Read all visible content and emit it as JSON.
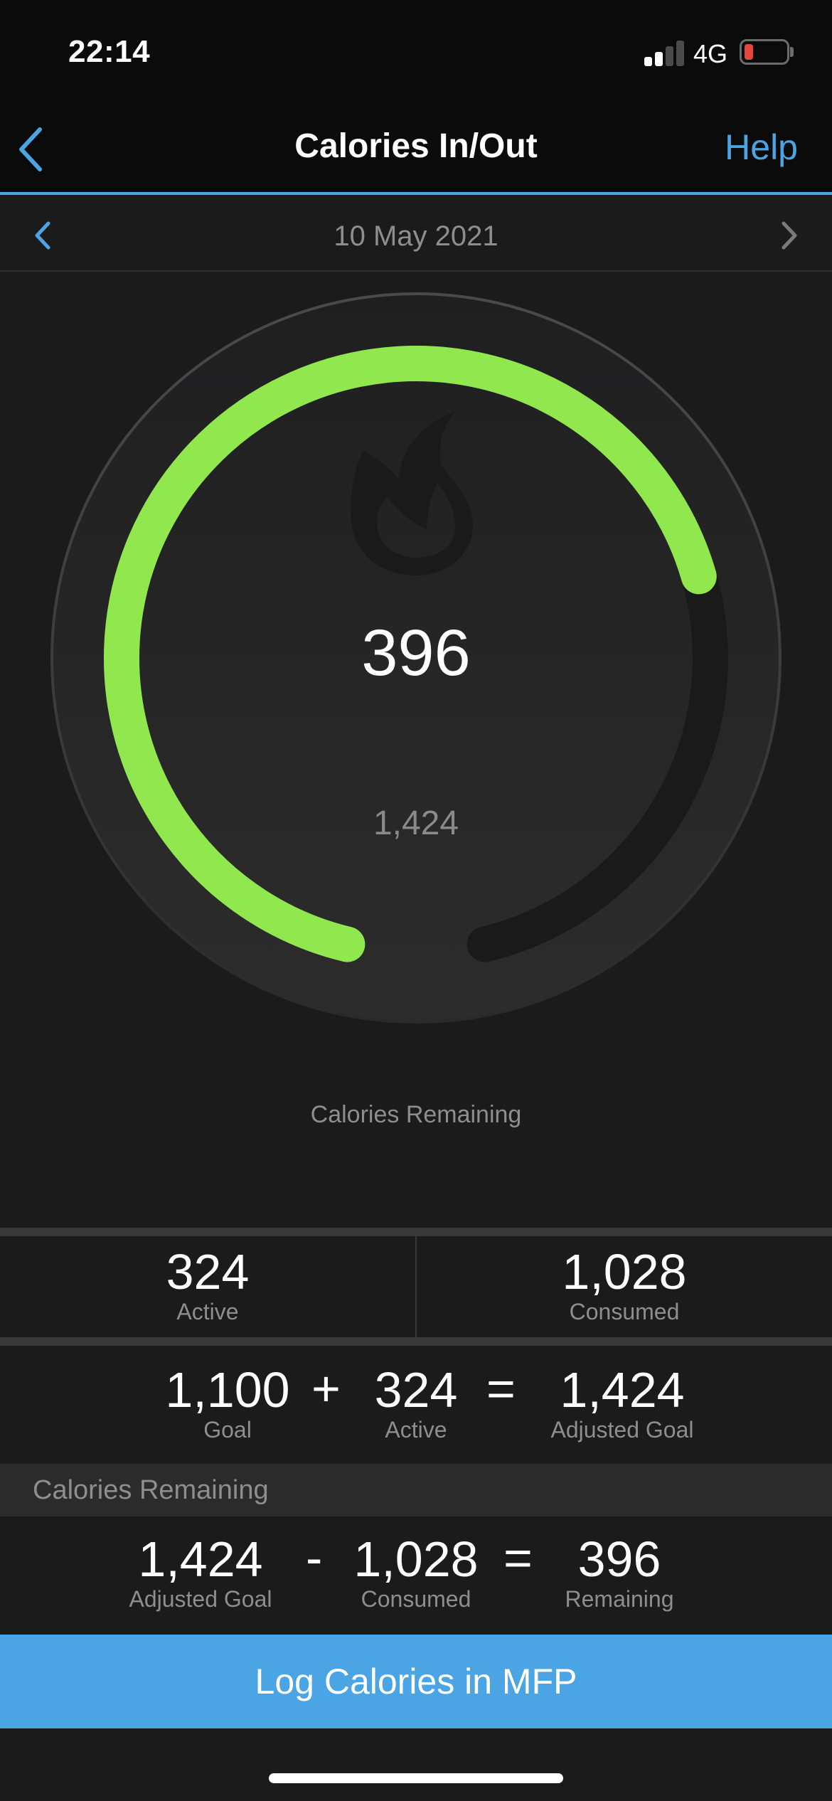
{
  "status_bar": {
    "time": "22:14",
    "network": "4G",
    "signal_bars_active": 2,
    "signal_bars_total": 4,
    "battery_level": 0.1,
    "battery_color": "#e5473d"
  },
  "nav": {
    "back_icon": "chevron-left-icon",
    "title": "Calories In/Out",
    "help_label": "Help"
  },
  "date_nav": {
    "prev_icon": "chevron-left-icon",
    "date": "10 May 2021",
    "next_icon": "chevron-right-icon"
  },
  "gauge": {
    "icon": "flame-icon",
    "remaining": "396",
    "adjusted_goal": "1,424",
    "caption": "Calories Remaining",
    "progress_fraction": 0.722,
    "progress_color": "#90e84e",
    "track_color": "#1a1a1a"
  },
  "summary": {
    "active_value": "324",
    "active_label": "Active",
    "consumed_value": "1,028",
    "consumed_label": "Consumed"
  },
  "goal_equation": {
    "terms": [
      {
        "value": "1,100",
        "label": "Goal"
      },
      {
        "value": "324",
        "label": "Active"
      },
      {
        "value": "1,424",
        "label": "Adjusted Goal"
      }
    ],
    "operators": [
      "+",
      "="
    ]
  },
  "remaining_section": {
    "header": "Calories Remaining",
    "terms": [
      {
        "value": "1,424",
        "label": "Adjusted Goal"
      },
      {
        "value": "1,028",
        "label": "Consumed"
      },
      {
        "value": "396",
        "label": "Remaining"
      }
    ],
    "operators": [
      "-",
      "="
    ]
  },
  "actions": {
    "log_button_label": "Log Calories in MFP"
  },
  "colors": {
    "accent": "#4ba4e3",
    "background": "#1b1b1c",
    "header_background": "#0b0b0b"
  }
}
